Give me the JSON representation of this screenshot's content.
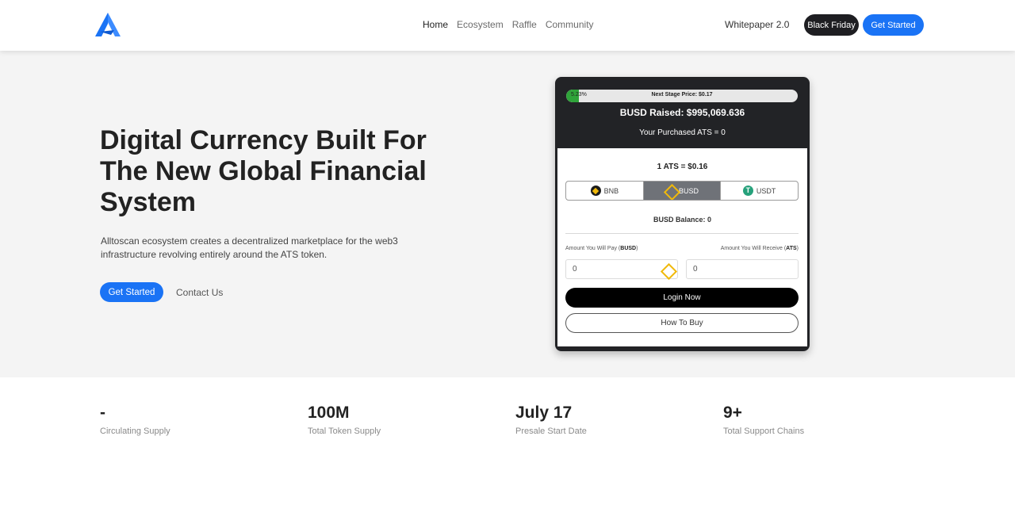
{
  "header": {
    "nav": [
      "Home",
      "Ecosystem",
      "Raffle",
      "Community"
    ],
    "whitepaper": "Whitepaper 2.0",
    "black_friday": "Black Friday",
    "get_started": "Get Started",
    "logo_icon": "alltoscan-logo-icon",
    "brand_color": "#1a73f5"
  },
  "hero": {
    "title": "Digital Currency Built For The New Global Financial System",
    "description": "Alltoscan ecosystem creates a decentralized marketplace for the web3 infrastructure revolving entirely around the ATS token.",
    "get_started": "Get Started",
    "contact": "Contact Us"
  },
  "widget": {
    "progress_pct": "5.23%",
    "progress_value": 0.0523,
    "next_stage": "Next Stage Price: $0.17",
    "raised": "BUSD Raised: $995,069.636",
    "purchased": "Your Purchased ATS = 0",
    "rate": "1 ATS = $0.16",
    "tabs": [
      {
        "label": "BNB",
        "icon": "bnb-icon"
      },
      {
        "label": "BUSD",
        "icon": "busd-icon"
      },
      {
        "label": "USDT",
        "icon": "usdt-icon"
      }
    ],
    "active_tab": "BUSD",
    "balance": "BUSD Balance: 0",
    "pay_label_prefix": "Amount You Will Pay (",
    "pay_label_unit": "BUSD",
    "recv_label_prefix": "Amount You Will Receive (",
    "recv_label_unit": "ATS",
    "label_suffix": ")",
    "pay_value": "0",
    "recv_value": "0",
    "login": "Login Now",
    "how_to_buy": "How To Buy"
  },
  "stats": [
    {
      "value": "-",
      "label": "Circulating Supply"
    },
    {
      "value": "100M",
      "label": "Total Token Supply"
    },
    {
      "value": "July 17",
      "label": "Presale Start Date"
    },
    {
      "value": "9+",
      "label": "Total Support Chains"
    }
  ]
}
